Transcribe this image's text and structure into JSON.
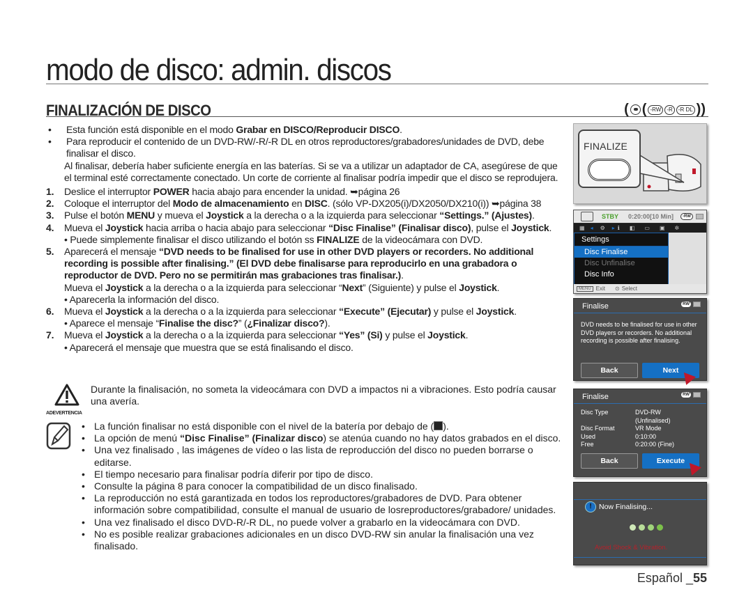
{
  "page": {
    "main_title": "modo de disco: admin. discos",
    "section_title": "FINALIZACIÓN DE DISCO",
    "disc_badges": [
      "-RW",
      "-R",
      "-R DL"
    ],
    "footer_lang": "Español _",
    "footer_page": "55"
  },
  "intro": [
    {
      "pre": "Esta función está disponible en el modo ",
      "bold": "Grabar en DISCO/Reproducir DISCO",
      "post": "."
    },
    {
      "pre": "Para reproducir el contenido de un DVD-RW/-R/-R DL en otros reproductores/grabadores/unidades de DVD, debe finalisar el disco.",
      "bold": "",
      "post": ""
    },
    {
      "pre": "Al finalisar, debería haber suficiente energía en las baterías. Si se va a utilizar un adaptador de CA, asegúrese de que el terminal esté correctamente conectado. Un corte de corriente al finalisar podría impedir que el disco se reprodujera.",
      "bold": "",
      "post": ""
    }
  ],
  "steps": {
    "s1": {
      "num": "1.",
      "a": "Deslice el interruptor ",
      "b": "POWER",
      "c": " hacia abajo para encender la unidad. ➥página 26"
    },
    "s2": {
      "num": "2.",
      "a": "Coloque el interruptor del ",
      "b": "Modo de almacenamiento",
      "c": " en ",
      "d": "DISC",
      "e": ". (sólo VP-DX205(i)/DX2050/DX210(i)) ➥página 38"
    },
    "s3": {
      "num": "3.",
      "a": "Pulse el botón ",
      "b": "MENU",
      "c": " y mueva el ",
      "d": "Joystick",
      "e": " a la derecha o a la izquierda para seleccionar ",
      "f": "“Settings.” (Ajustes)",
      "g": "."
    },
    "s4": {
      "num": "4.",
      "a": "Mueva el ",
      "b": "Joystick",
      "c": " hacia arriba o hacia abajo para seleccionar ",
      "d": "“Disc Finalise” (Finalisar disco)",
      "e": ", pulse el ",
      "f": "Joystick",
      "g": ".",
      "sub_a": "• Puede simplemente finalisar el disco utilizando el botón ss ",
      "sub_b": "FINALIZE",
      "sub_c": " de la videocámara con DVD."
    },
    "s5": {
      "num": "5.",
      "a": "Aparecerá el mensaje ",
      "b": "“DVD needs to be finalised for use in other DVD players or recorders. No additional recording is possible after finalising.” (El DVD debe finalisarse para reproducirlo en una grabadora o reproductor de DVD. Pero no se permitirán mas grabaciones tras finalisar.)",
      "c": ".",
      "l2a": "Mueva el ",
      "l2b": "Joystick",
      "l2c": " a la derecha o a la izquierda para seleccionar “",
      "l2d": "Next",
      "l2e": "” (Siguiente) y pulse el ",
      "l2f": "Joystick",
      "l2g": ".",
      "sub": "• Aparecerla la información del disco."
    },
    "s6": {
      "num": "6.",
      "a": "Mueva el ",
      "b": "Joystick",
      "c": " a la derecha o a la izquierda para seleccionar ",
      "d": "“Execute” (Ejecutar)",
      "e": " y pulse el ",
      "f": "Joystick",
      "g": ".",
      "sub_a": "• Aparece el mensaje “",
      "sub_b": "Finalise the disc?",
      "sub_c": "” (",
      "sub_d": "¿Finalizar disco?",
      "sub_e": ")."
    },
    "s7": {
      "num": "7.",
      "a": "Mueva el ",
      "b": "Joystick",
      "c": " a la derecha o a la izquierda  para seleccionar ",
      "d": "“Yes” (Si)",
      "e": " y pulse el ",
      "f": "Joystick",
      "g": ".",
      "sub": "• Aparecerá el mensaje que muestra que se está finalisando el disco."
    }
  },
  "warning": {
    "label": "ADEVERTENCIA",
    "text": "Durante la finalisación, no someta la videocámara con DVD a impactos ni a vibraciones. Esto podría causar una avería."
  },
  "notes": {
    "n1": "La función finalisar no está disponible con el nivel de la batería por debajo de (",
    "n1_end": ").",
    "n2a": "La opción de menú ",
    "n2b": "“Disc Finalise” (Finalizar disco",
    "n2c": ") se atenúa cuando no hay datos grabados en el disco.",
    "n3": "Una vez finalisado , las imágenes de vídeo o las lista de reproducción del disco no pueden borrarse o editarse.",
    "n4": "El tiempo necesario para finalisar podría diferir por tipo de disco.",
    "n5": "Consulte la página 8 para conocer la compatibilidad de un disco finalisado.",
    "n6": "La reproducción no está garantizada en todos los reproductores/grabadores de DVD. Para obtener información sobre compatibilidad, consulte el manual de usuario de losreproductores/grabadore/ unidades.",
    "n7": "Una vez finalisado el disco DVD-R/-R DL, no puede volver a grabarlo en la videocámara con DVD.",
    "n8": "No es posible realizar grabaciones adicionales en un disco DVD-RW sin anular la finalisación una vez finalisado."
  },
  "screens": {
    "finalize_button_label": "FINALIZE",
    "menu": {
      "status": "STBY",
      "time": "0:20:00[10 Min]",
      "disc": "-RW",
      "title": "Settings",
      "items": [
        "Disc Finalise",
        "Disc Unfinalise",
        "Disc Info"
      ],
      "footer_menu": "MENU",
      "footer_exit": "Exit",
      "footer_select": "Select"
    },
    "confirm": {
      "title": "Finalise",
      "message": "DVD needs to be finalised for use in other DVD players or recorders. No additional recording is possible after finalising.",
      "back": "Back",
      "next": "Next"
    },
    "info": {
      "title": "Finalise",
      "rows": [
        {
          "k": "Disc Type",
          "v": "DVD-RW"
        },
        {
          "k": "",
          "v": "(Unfinalised)"
        },
        {
          "k": "Disc Format",
          "v": "VR Mode"
        },
        {
          "k": "Used",
          "v": "0:10:00"
        },
        {
          "k": "Free",
          "v": "0:20:00 (Fine)"
        }
      ],
      "back": "Back",
      "execute": "Execute"
    },
    "progress": {
      "message": "Now Finalising...",
      "warning": "Avoid Shock & Vibration.",
      "dot_colors": [
        "#cfe8b8",
        "#b8dd98",
        "#9fd37a",
        "#7cc04a"
      ]
    }
  }
}
